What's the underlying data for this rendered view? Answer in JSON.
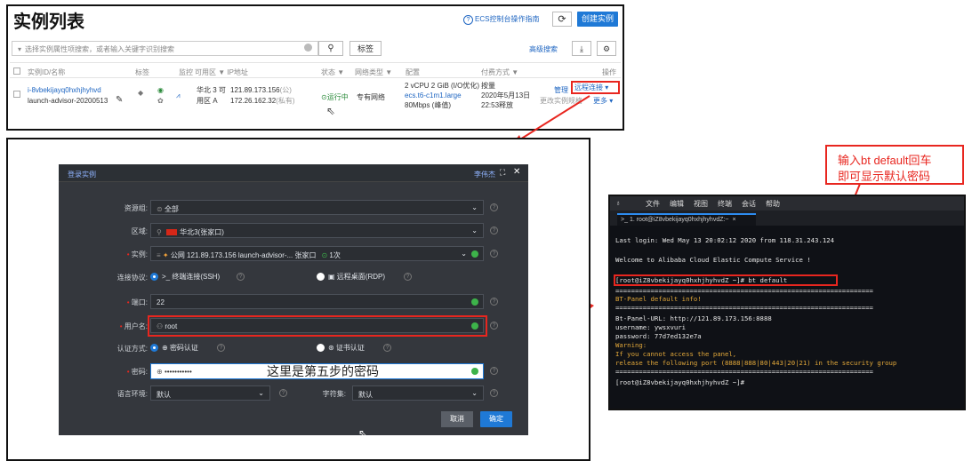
{
  "ecs": {
    "title": "实例列表",
    "guide_label": "ECS控制台操作指南",
    "refresh_icon": "refresh-icon",
    "create_button": "创建实例",
    "search_placeholder": "选择实例属性项搜索，或者输入关键字识别搜索",
    "tag_button": "标签",
    "advanced_search": "高级搜索",
    "columns": {
      "id": "实例ID/名称",
      "tags": "标签",
      "monitor": "监控",
      "zone_ip": "可用区 ▼  IP地址",
      "status": "状态 ▼",
      "network": "网络类型 ▼",
      "config": "配置",
      "billing": "付费方式 ▼",
      "actions": "操作"
    },
    "row": {
      "id": "i-8vbekijayq0hxhjhyhvd",
      "name": "launch-advisor-20200513",
      "zone_line1": "华北 3 可",
      "zone_line2": "用区 A",
      "ip_public": "121.89.173.156",
      "ip_public_suffix": "(公)",
      "ip_private": "172.26.162.32",
      "ip_private_suffix": "(私有)",
      "status": "运行中",
      "network": "专有网络",
      "config_line1": "2 vCPU 2 GiB (I/O优化)",
      "config_line2": "ecs.t6-c1m1.large",
      "config_line3": "80Mbps (峰值)",
      "billing_line1": "按量",
      "billing_line2": "2020年5月13日",
      "billing_line3": "22:53释放",
      "manage": "管理",
      "remote": "远程连接 ▾",
      "change_config": "更改实例规格",
      "more": "更多 ▾"
    }
  },
  "dialog": {
    "title": "登录实例",
    "user": "李伟杰",
    "fields": {
      "resource_group_label": "资源组:",
      "resource_group_value": "全部",
      "region_label": "区域:",
      "region_value": "华北3(张家口)",
      "instance_label": "实例:",
      "instance_value": "公网  121.89.173.156    launch-advisor-...  张家口",
      "instance_count": "1次",
      "protocol_label": "连接协议:",
      "protocol_ssh": "终端连接(SSH)",
      "protocol_rdp": "远程桌面(RDP)",
      "port_label": "端口:",
      "port_value": "22",
      "username_label": "用户名:",
      "username_value": "root",
      "auth_label": "认证方式:",
      "auth_password": "密码认证",
      "auth_cert": "证书认证",
      "password_label": "密码:",
      "password_value": "•••••••••••",
      "password_note": "这里是第五步的密码",
      "locale_label": "语言环境:",
      "locale_value": "默认",
      "charset_label": "字符集:",
      "charset_value": "默认"
    },
    "cancel": "取消",
    "confirm": "确定"
  },
  "annotation": {
    "line1": "输入bt default回车",
    "line2": "即可显示默认密码"
  },
  "terminal": {
    "menu": [
      "文件",
      "编辑",
      "视图",
      "终端",
      "会话",
      "帮助"
    ],
    "tab": "1. root@iZ8vbekijayq0hxhjhyhvdZ:~",
    "lines": {
      "l1": "Last login: Wed May 13 20:02:12 2020 from 118.31.243.124",
      "l2": "Welcome to Alibaba Cloud Elastic Compute Service !",
      "l3": "[root@iZ8vbekijayq0hxhjhyhvdZ ~]# bt default",
      "sep1": "==================================================================",
      "l4": "BT-Panel default info!",
      "sep2": "==================================================================",
      "l5": "Bt-Panel-URL: http://121.89.173.156:8888",
      "l6": "username: ywsxvuri",
      "l7": "password: 77d7ed132e7a",
      "l8": "Warning:",
      "l9": "If you cannot access the panel,",
      "l10": "release the following port (8888|888|80|443|20|21) in the security group",
      "sep3": "==================================================================",
      "l11": "[root@iZ8vbekijayq0hxhjhyhvdZ ~]#"
    }
  },
  "colors": {
    "annotation_red": "#e8261f",
    "accent_blue": "#1f79d6",
    "status_green": "#3db34a",
    "terminal_green": "#5fd35a",
    "terminal_yellow": "#e2a83a"
  }
}
